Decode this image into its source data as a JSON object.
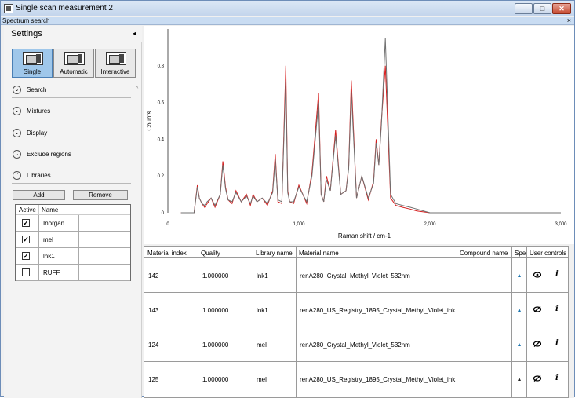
{
  "window": {
    "title": "Single scan measurement 2",
    "tab_label": "Spectrum search",
    "tab_close": "×",
    "minimize": "–",
    "maximize": "□",
    "close": "✕"
  },
  "sidebar": {
    "header": "Settings",
    "collapse_glyph": "◂",
    "modes": [
      {
        "label": "Single",
        "icon": "single-scan-icon",
        "active": true
      },
      {
        "label": "Automatic",
        "icon": "automatic-scan-icon",
        "active": false
      },
      {
        "label": "Interactive",
        "icon": "interactive-scan-icon",
        "active": false
      }
    ],
    "sections": [
      {
        "label": "Search",
        "state": "collapsed"
      },
      {
        "label": "Mixtures",
        "state": "collapsed"
      },
      {
        "label": "Display",
        "state": "collapsed"
      },
      {
        "label": "Exclude regions",
        "state": "collapsed"
      },
      {
        "label": "Libraries",
        "state": "expanded"
      }
    ],
    "chevron_down": "⌄",
    "chevron_up": "⌃",
    "libraries": {
      "add_label": "Add",
      "remove_label": "Remove",
      "columns": [
        "Active",
        "Name"
      ],
      "rows": [
        {
          "active": true,
          "name": "Inorgan"
        },
        {
          "active": true,
          "name": "mel"
        },
        {
          "active": true,
          "name": "lnk1"
        },
        {
          "active": false,
          "name": "RUFF"
        }
      ]
    }
  },
  "chart_data": {
    "type": "line",
    "title": "",
    "xlabel": "Raman shift / cm-1",
    "ylabel": "Counts",
    "xlim": [
      0,
      3000
    ],
    "ylim": [
      0,
      1.0
    ],
    "xticks": [
      "0",
      "1,000",
      "2,000",
      "3,000"
    ],
    "xtick_values": [
      0,
      1000,
      2000,
      3000
    ],
    "yticks": [
      "0",
      "0.2",
      "0.4",
      "0.6",
      "0.8"
    ],
    "ytick_values": [
      0,
      0.2,
      0.4,
      0.6,
      0.8
    ],
    "grid": false,
    "series": [
      {
        "color": "#d62020",
        "x": [
          100,
          200,
          225,
          240,
          260,
          280,
          300,
          330,
          360,
          400,
          420,
          440,
          460,
          490,
          520,
          560,
          600,
          630,
          650,
          680,
          720,
          760,
          800,
          820,
          840,
          870,
          900,
          915,
          930,
          960,
          1000,
          1060,
          1100,
          1150,
          1170,
          1190,
          1210,
          1240,
          1280,
          1320,
          1360,
          1380,
          1400,
          1440,
          1480,
          1530,
          1570,
          1590,
          1610,
          1630,
          1660,
          1700,
          1740,
          1790,
          1850,
          1900,
          2000,
          3000
        ],
        "y": [
          0,
          0,
          0.15,
          0.08,
          0.05,
          0.03,
          0.05,
          0.08,
          0.03,
          0.1,
          0.28,
          0.14,
          0.07,
          0.05,
          0.12,
          0.06,
          0.1,
          0.04,
          0.1,
          0.06,
          0.08,
          0.04,
          0.12,
          0.32,
          0.06,
          0.05,
          0.8,
          0.12,
          0.06,
          0.05,
          0.15,
          0.05,
          0.22,
          0.65,
          0.1,
          0.06,
          0.2,
          0.12,
          0.45,
          0.1,
          0.12,
          0.25,
          0.72,
          0.08,
          0.2,
          0.07,
          0.17,
          0.4,
          0.26,
          0.5,
          0.8,
          0.08,
          0.04,
          0.03,
          0.02,
          0.01,
          0,
          0
        ]
      },
      {
        "color": "#707070",
        "x": [
          100,
          200,
          225,
          240,
          260,
          280,
          300,
          330,
          360,
          400,
          420,
          440,
          460,
          490,
          520,
          560,
          600,
          630,
          650,
          680,
          720,
          760,
          800,
          820,
          840,
          870,
          900,
          915,
          930,
          960,
          1000,
          1060,
          1100,
          1150,
          1170,
          1190,
          1210,
          1240,
          1280,
          1320,
          1360,
          1380,
          1400,
          1440,
          1480,
          1530,
          1570,
          1590,
          1610,
          1630,
          1660,
          1700,
          1740,
          1790,
          1850,
          1900,
          2000,
          3000
        ],
        "y": [
          0,
          0,
          0.14,
          0.08,
          0.05,
          0.04,
          0.06,
          0.08,
          0.04,
          0.1,
          0.26,
          0.13,
          0.07,
          0.06,
          0.11,
          0.06,
          0.09,
          0.05,
          0.09,
          0.06,
          0.08,
          0.05,
          0.11,
          0.29,
          0.07,
          0.06,
          0.72,
          0.11,
          0.06,
          0.06,
          0.14,
          0.06,
          0.2,
          0.6,
          0.1,
          0.06,
          0.18,
          0.12,
          0.42,
          0.1,
          0.12,
          0.24,
          0.66,
          0.08,
          0.2,
          0.08,
          0.16,
          0.38,
          0.26,
          0.48,
          0.95,
          0.1,
          0.05,
          0.04,
          0.03,
          0.02,
          0,
          0
        ]
      }
    ]
  },
  "results": {
    "columns": [
      "Material index",
      "Quality",
      "Library name",
      "Material name",
      "Compound name",
      "Spe",
      "User controls"
    ],
    "rows": [
      {
        "index": "142",
        "quality": "1.000000",
        "library": "lnk1",
        "material": "renA280_Crystal_Methyl_Violet_532nm",
        "compound": "",
        "visibility": "shown",
        "info": "i"
      },
      {
        "index": "143",
        "quality": "1.000000",
        "library": "lnk1",
        "material": "renA280_US_Registry_1895_Crystal_Methyl_Violet_ink",
        "compound": "",
        "visibility": "hidden",
        "info": "i"
      },
      {
        "index": "124",
        "quality": "1.000000",
        "library": "mel",
        "material": "renA280_Crystal_Methyl_Violet_532nm",
        "compound": "",
        "visibility": "hidden",
        "info": "i"
      },
      {
        "index": "125",
        "quality": "1.000000",
        "library": "mel",
        "material": "renA280_US_Registry_1895_Crystal_Methyl_Violet_ink",
        "compound": "",
        "visibility": "hidden",
        "info": "i"
      }
    ]
  }
}
